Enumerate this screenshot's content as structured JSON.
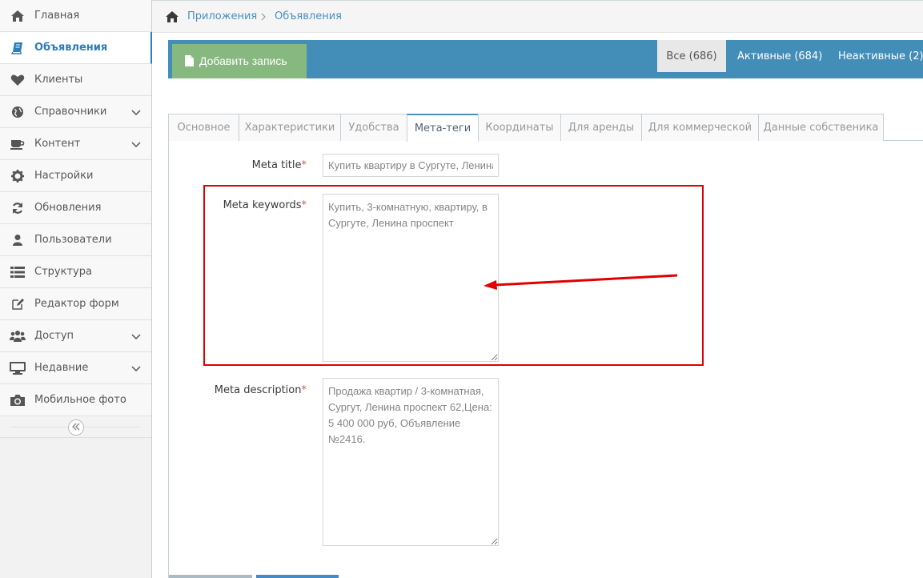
{
  "sidebar": {
    "items": [
      {
        "label": "Главная",
        "icon": "home-icon",
        "chevron": false,
        "active": false
      },
      {
        "label": "Объявления",
        "icon": "book-icon",
        "chevron": false,
        "active": true
      },
      {
        "label": "Клиенты",
        "icon": "heart-icon",
        "chevron": false,
        "active": false
      },
      {
        "label": "Справочники",
        "icon": "globe-icon",
        "chevron": true,
        "active": false
      },
      {
        "label": "Контент",
        "icon": "coffee-icon",
        "chevron": true,
        "active": false
      },
      {
        "label": "Настройки",
        "icon": "cog-icon",
        "chevron": false,
        "active": false
      },
      {
        "label": "Обновления",
        "icon": "refresh-icon",
        "chevron": false,
        "active": false
      },
      {
        "label": "Пользователи",
        "icon": "user-icon",
        "chevron": false,
        "active": false
      },
      {
        "label": "Структура",
        "icon": "list-icon",
        "chevron": false,
        "active": false
      },
      {
        "label": "Редактор форм",
        "icon": "edit-icon",
        "chevron": false,
        "active": false
      },
      {
        "label": "Доступ",
        "icon": "users-icon",
        "chevron": true,
        "active": false
      },
      {
        "label": "Недавние",
        "icon": "desktop-icon",
        "chevron": true,
        "active": false
      },
      {
        "label": "Мобильное фото",
        "icon": "camera-icon",
        "chevron": false,
        "active": false
      }
    ]
  },
  "breadcrumb": {
    "items": [
      "Приложения",
      "Объявления"
    ]
  },
  "toolbar": {
    "add_label": "Добавить запись",
    "filters": {
      "all": "Все (686)",
      "active": "Активные (684)",
      "inactive": "Неактивные (2)"
    }
  },
  "tabs": [
    "Основное",
    "Характеристики",
    "Удобства",
    "Мета-теги",
    "Координаты",
    "Для аренды",
    "Для коммерческой",
    "Данные собственика"
  ],
  "active_tab": "Мета-теги",
  "form": {
    "meta_title": {
      "label": "Meta title",
      "required_mark": "*",
      "value": "Купить квартиру в Сургуте, Ленина"
    },
    "meta_keywords": {
      "label": "Meta keywords",
      "required_mark": "*",
      "value": "Купить, 3-комнатную, квартиру, в Сургуте, Ленина проспект"
    },
    "meta_description": {
      "label": "Meta description",
      "required_mark": "*",
      "value": "Продажа квартир / 3-комнатная, Сургут, Ленина проспект 62,Цена: 5 400 000 руб, Объявление №2416."
    }
  },
  "colors": {
    "accent": "#438eb9",
    "link": "#4c8fbd",
    "success": "#87b87f",
    "required": "#d15b47",
    "annotation": "#e00000"
  }
}
